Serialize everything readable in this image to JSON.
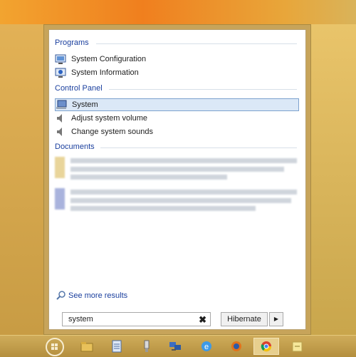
{
  "programs": {
    "header": "Programs",
    "items": [
      {
        "label": "System Configuration",
        "icon": "system-configuration-icon"
      },
      {
        "label": "System Information",
        "icon": "system-information-icon"
      }
    ]
  },
  "control_panel": {
    "header": "Control Panel",
    "items": [
      {
        "label": "System",
        "icon": "system-icon",
        "selected": true
      },
      {
        "label": "Adjust system volume",
        "icon": "speaker-icon"
      },
      {
        "label": "Change system sounds",
        "icon": "speaker-icon"
      }
    ]
  },
  "documents": {
    "header": "Documents"
  },
  "see_more": {
    "label": "See more results"
  },
  "search": {
    "value": "system",
    "clear_glyph": "✖"
  },
  "hibernate": {
    "label": "Hibernate",
    "arrow": "▶"
  },
  "taskbar": {
    "icons": [
      "start-orb-icon",
      "file-explorer-icon",
      "notepad-icon",
      "usb-icon",
      "network-icon",
      "internet-explorer-icon",
      "firefox-icon",
      "chrome-icon",
      "sticky-notes-icon"
    ],
    "active": "chrome-icon"
  }
}
